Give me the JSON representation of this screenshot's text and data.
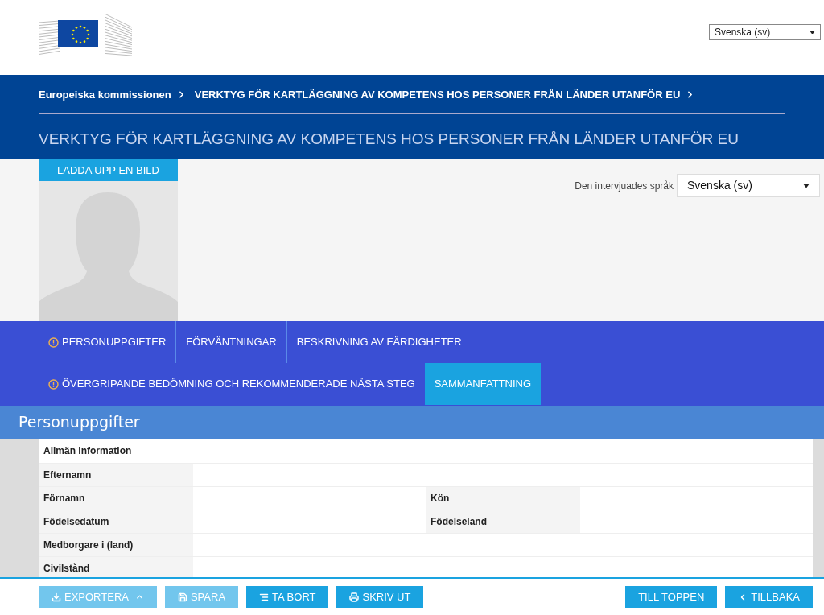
{
  "header": {
    "language_select": {
      "value": "Svenska (sv)"
    }
  },
  "breadcrumb": [
    "Europeiska kommissionen",
    "VERKTYG FÖR KARTLÄGGNING AV KOMPETENS HOS PERSONER FRÅN LÄNDER UTANFÖR EU"
  ],
  "page_title": "VERKTYG FÖR KARTLÄGGNING AV KOMPETENS HOS PERSONER FRÅN LÄNDER UTANFÖR EU",
  "profile": {
    "upload_button": "LADDA UPP EN BILD",
    "interviewee_language": {
      "label": "Den intervjuades språk",
      "value": "Svenska (sv)"
    }
  },
  "tab_rows": [
    [
      {
        "label": "PERSONUPPGIFTER",
        "warning": true,
        "selected": false
      },
      {
        "label": "FÖRVÄNTNINGAR",
        "warning": false,
        "selected": false
      },
      {
        "label": "BESKRIVNING AV FÄRDIGHETER",
        "warning": false,
        "selected": false
      }
    ],
    [
      {
        "label": "ÖVERGRIPANDE BEDÖMNING OCH REKOMMENDERADE NÄSTA STEG",
        "warning": true,
        "selected": false
      },
      {
        "label": "SAMMANFATTNING",
        "warning": false,
        "selected": true
      }
    ]
  ],
  "section_title": "Personuppgifter",
  "table": {
    "heading": "Allmän information",
    "rows": [
      {
        "labels": [
          "Efternamn"
        ]
      },
      {
        "labels": [
          "Förnamn",
          "Kön"
        ]
      },
      {
        "labels": [
          "Födelsedatum",
          "Födelseland"
        ]
      },
      {
        "labels": [
          "Medborgare i (land)"
        ]
      },
      {
        "labels": [
          "Civilstånd"
        ]
      }
    ]
  },
  "footer": {
    "left": [
      {
        "label": "EXPORTERA",
        "kind": "download",
        "caret": true,
        "disabled": true
      },
      {
        "label": "SPARA",
        "kind": "save",
        "caret": false,
        "disabled": true
      },
      {
        "label": "TA BORT",
        "kind": "eraser",
        "caret": false,
        "disabled": false
      },
      {
        "label": "SKRIV UT",
        "kind": "print",
        "caret": false,
        "disabled": false
      }
    ],
    "right": [
      {
        "label": "TILL TOPPEN",
        "kind": "plain",
        "disabled": false
      },
      {
        "label": "TILLBAKA",
        "kind": "back",
        "disabled": false
      }
    ]
  }
}
